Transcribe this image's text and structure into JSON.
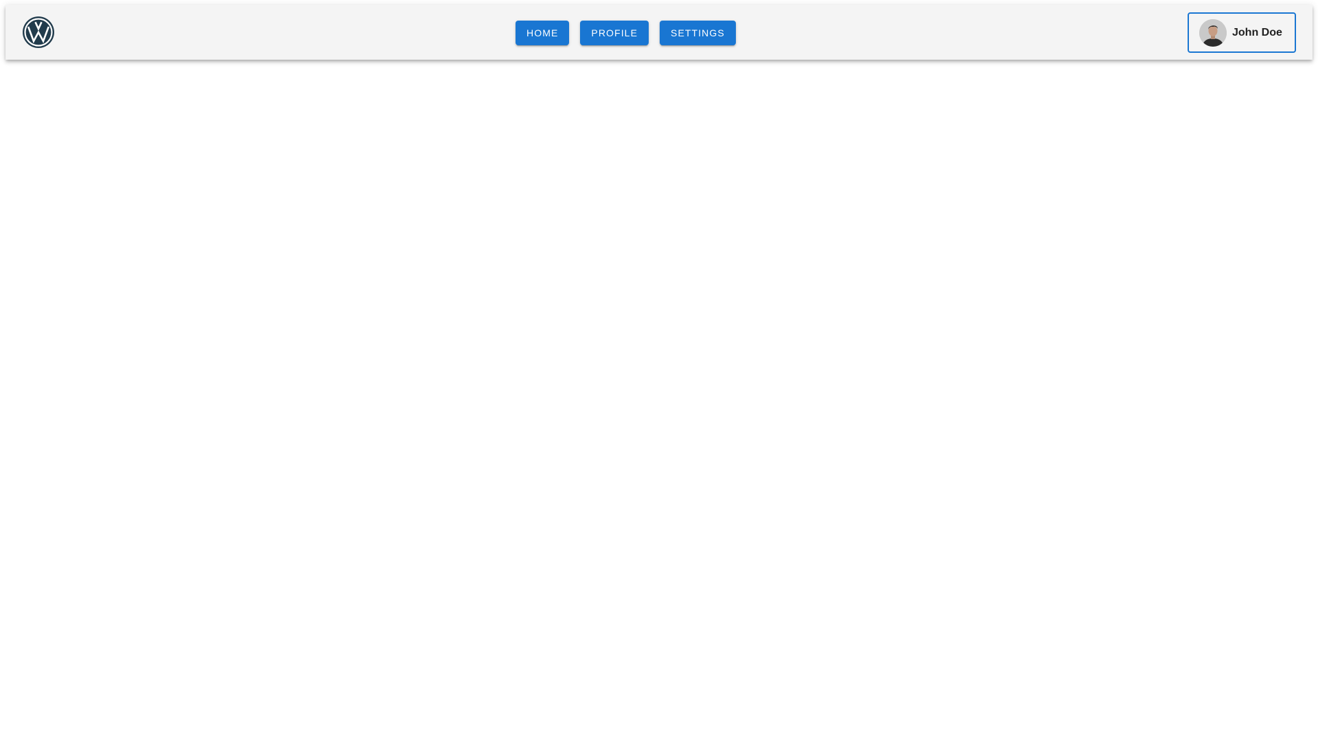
{
  "header": {
    "logo_icon": "vw-logo-icon",
    "brand_color": "#1976d2",
    "nav": [
      {
        "label": "HOME"
      },
      {
        "label": "PROFILE"
      },
      {
        "label": "SETTINGS"
      }
    ],
    "user": {
      "name": "John Doe",
      "avatar_icon": "user-avatar-photo"
    }
  }
}
